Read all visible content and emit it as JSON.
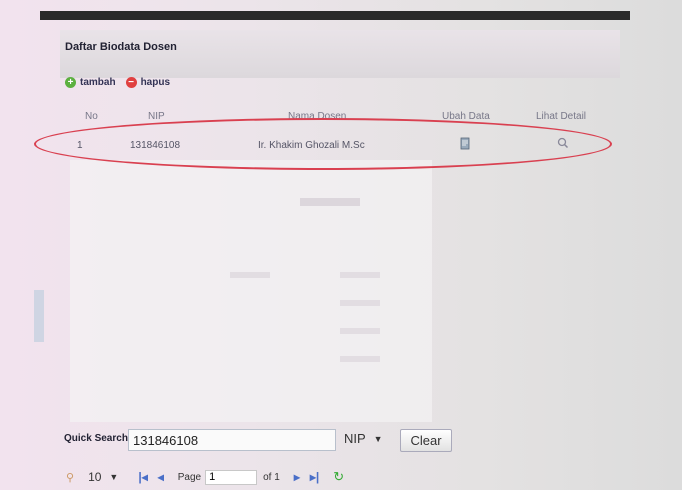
{
  "panel": {
    "title": "Daftar Biodata Dosen"
  },
  "toolbar": {
    "add_label": "tambah",
    "delete_label": "hapus"
  },
  "table": {
    "columns": [
      "No",
      "NIP",
      "Nama Dosen",
      "Ubah Data",
      "Lihat Detail"
    ],
    "rows": [
      {
        "no": "1",
        "nip": "131846108",
        "nama": "Ir. Khakim Ghozali M.Sc"
      }
    ]
  },
  "search": {
    "label": "Quick Search",
    "value": "131846108",
    "field": "NIP",
    "clear_label": "Clear"
  },
  "pager": {
    "page_size": "10",
    "page_label": "Page",
    "page_value": "1",
    "of_label": "of 1"
  },
  "colors": {
    "highlight": "#d94050",
    "add": "#5cb040",
    "delete": "#e04040"
  }
}
